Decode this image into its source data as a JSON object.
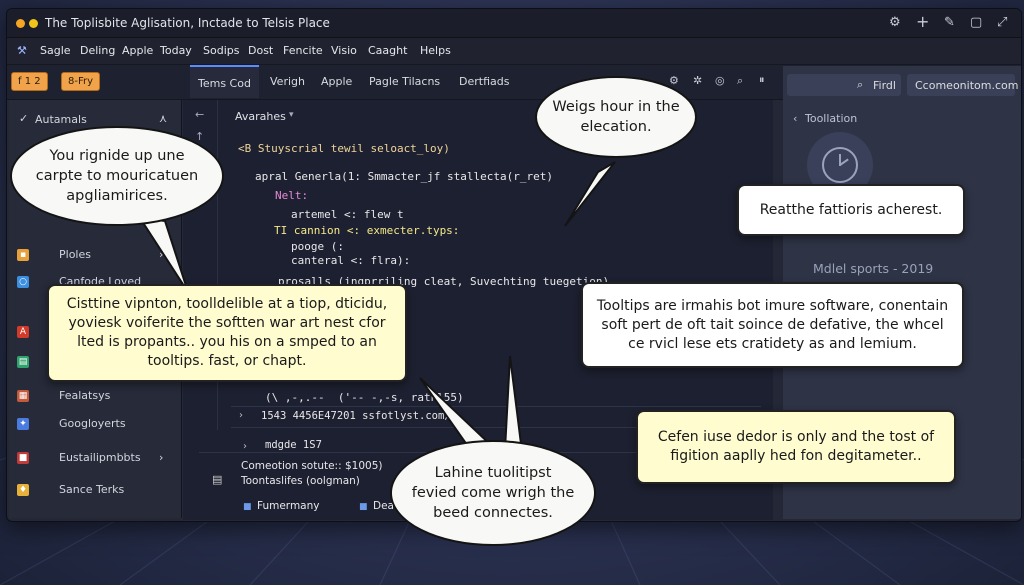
{
  "window": {
    "title": "The Toplisbite Aglisation, Inctade to Telsis Place"
  },
  "menu": [
    "Sagle",
    "Deling",
    "Apple",
    "Today",
    "Sodips",
    "Dost",
    "Fencite",
    "Visio",
    "Caaght",
    "Helps"
  ],
  "toolbar_badges": [
    "f 1 2",
    "8-Fry"
  ],
  "tabs": [
    "Tems Cod",
    "Verigh",
    "Apple",
    "Pagle Tilacns",
    "Dertfiads"
  ],
  "editor": {
    "dropdown_label": "Avarahes",
    "code_lines": [
      "<B Stuyscrial tewil seloact_loy)",
      "apral Generla(1: Smmacter_jf stallecta(r_ret)",
      "Nelt:",
      "artemel <: flew t",
      "TI cannion <: exmecter.typs:",
      "pooge (:",
      "canteral <: flra):",
      "prosalls (ingprriling cleat, Suvechting tuegetion)",
      "(\\ ,-,.--  ('-- -,-s, rathl55)"
    ],
    "path_line": "1543 4456E47201 ssfotlyst.com/",
    "middle_line": "mdgde 1S7",
    "console": {
      "line1": "Comeotion sotute:: $1005)",
      "line2": "Toontaslifes (oolgman)",
      "item1": "Fumermany",
      "item2": "Deat tast"
    }
  },
  "sidebar": {
    "header": "Autamals",
    "items": [
      "Ploles",
      "Canfode Loved",
      "Fealatsys",
      "Googloyerts",
      "Eustailipmbbts",
      "Sance Terks"
    ]
  },
  "right_panel": {
    "search_placeholder": "Firdl",
    "domain": "Ccomeonitom.com",
    "section": "Toollation",
    "caption": "Mdlel sports - 2019"
  },
  "callouts": {
    "bubble1": "You rignide up une carpte to mouricatuen apgliamirices.",
    "bubble2": "Weigs hour in the elecation.",
    "bubble3": "Lahine tuolitipst fevied come wrigh the beed connectes.",
    "box1": "Cisttine vipnton, toolldelible at a tiop, dticidu, yoviesk voiferite the softten war art nest cfor lted is propants.. you his on a smped to an tooltips. fast, or chapt.",
    "box2": "Reatthe fattioris acherest.",
    "box3": "Tooltips are irmahis bot imure software, conentain soft pert de oft tait soince de defative, the whcel ce rvicl lese ets cratidety as and lemium.",
    "box4": "Cefen iuse dedor is only and the tost of figition aaplly hed fon degitameter.."
  },
  "colors": {
    "yellow_callout": "#fffcd0",
    "badge_orange": "#f0a34a",
    "accent_blue": "#5b8cff"
  }
}
